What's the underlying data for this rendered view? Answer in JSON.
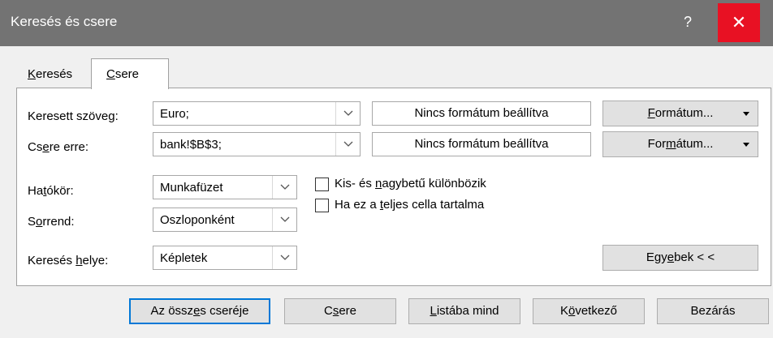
{
  "window": {
    "title": "Keresés és csere",
    "help_label": "?",
    "close_label": "✕"
  },
  "tabs": [
    {
      "pre": "",
      "mnemonic": "K",
      "post": "eresés",
      "active": false
    },
    {
      "pre": "",
      "mnemonic": "C",
      "post": "sere",
      "active": true
    }
  ],
  "find": {
    "label_pre": "Keresett szöve",
    "label_mn": "g",
    "label_post": ":",
    "value": "Euro;",
    "format_status": "Nincs formátum beállítva",
    "format_btn_pre": "",
    "format_btn_mn": "F",
    "format_btn_post": "ormátum..."
  },
  "replace": {
    "label_pre": "Cs",
    "label_mn": "e",
    "label_post": "re erre:",
    "value": "bank!$B$3;",
    "format_status": "Nincs formátum beállítva",
    "format_btn_pre": "For",
    "format_btn_mn": "m",
    "format_btn_post": "átum..."
  },
  "options": {
    "scope": {
      "label_pre": "Ha",
      "label_mn": "t",
      "label_post": "ókör:",
      "value": "Munkafüzet"
    },
    "order": {
      "label_pre": "S",
      "label_mn": "o",
      "label_post": "rrend:",
      "value": "Oszloponként"
    },
    "lookin": {
      "label_pre": "Keresés ",
      "label_mn": "h",
      "label_post": "elye:",
      "value": "Képletek"
    },
    "match_case": {
      "pre": "Kis- és ",
      "mn": "n",
      "post": "agybetű különbözik",
      "checked": false
    },
    "match_entire": {
      "pre": "Ha ez a ",
      "mn": "t",
      "post": "eljes cella tartalma",
      "checked": false
    },
    "more_btn": {
      "pre": "Egy",
      "mn": "e",
      "post": "bek < <"
    }
  },
  "buttons": {
    "replace_all": {
      "pre": "Az össz",
      "mn": "e",
      "post": "s cseréje"
    },
    "replace": {
      "pre": "C",
      "mn": "s",
      "post": "ere"
    },
    "find_all": {
      "pre": "",
      "mn": "L",
      "post": "istába mind"
    },
    "find_next": {
      "pre": "K",
      "mn": "ö",
      "post": "vetkező"
    },
    "close": {
      "pre": "Bezárás",
      "mn": "",
      "post": ""
    }
  }
}
